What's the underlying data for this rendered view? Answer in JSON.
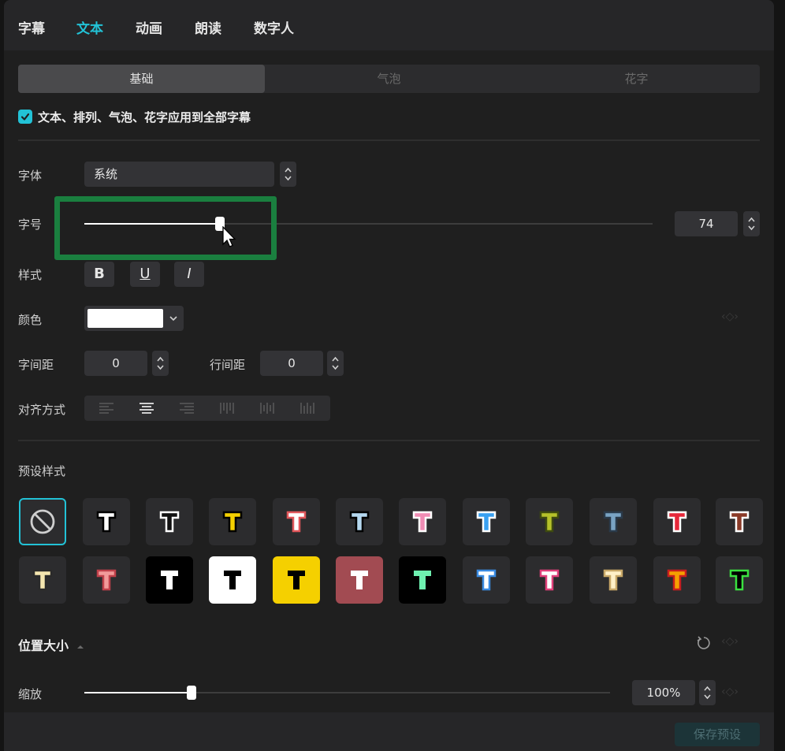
{
  "top_tabs": [
    "字幕",
    "文本",
    "动画",
    "朗读",
    "数字人"
  ],
  "active_top_tab": "文本",
  "sub_tabs": [
    "基础",
    "气泡",
    "花字"
  ],
  "active_sub_tab": "基础",
  "apply_all": {
    "label": "文本、排列、气泡、花字应用到全部字幕",
    "checked": true
  },
  "font": {
    "label": "字体",
    "value": "系统"
  },
  "font_size": {
    "label": "字号",
    "value": "74",
    "slider_fraction": 0.24
  },
  "style": {
    "label": "样式",
    "buttons": [
      "B",
      "U",
      "I"
    ]
  },
  "color": {
    "label": "颜色",
    "value": "#ffffff"
  },
  "letter_spacing": {
    "label": "字间距",
    "value": "0"
  },
  "line_spacing": {
    "label": "行间距",
    "value": "0"
  },
  "alignment": {
    "label": "对齐方式",
    "options": [
      "left",
      "center",
      "right",
      "top-vertical",
      "center-vertical",
      "bottom-vertical"
    ],
    "selected": "center"
  },
  "presets": {
    "label": "预设样式",
    "items": [
      {
        "name": "none",
        "bg": "#2c2c2e",
        "fill": "none"
      },
      {
        "name": "white-black-stroke",
        "bg": "#2c2c2e",
        "fill": "#ffffff",
        "stroke": "#000000"
      },
      {
        "name": "outline-white",
        "bg": "#2c2c2e",
        "fill": "#111111",
        "stroke": "#ffffff"
      },
      {
        "name": "yellow-black",
        "bg": "#2c2c2e",
        "fill": "#f5d000",
        "stroke": "#000000"
      },
      {
        "name": "white-red",
        "bg": "#2c2c2e",
        "fill": "#ffffff",
        "stroke": "#e0565a"
      },
      {
        "name": "lightblue-black",
        "bg": "#2c2c2e",
        "fill": "#b5d8ef",
        "stroke": "#000000"
      },
      {
        "name": "pink-white",
        "bg": "#2c2c2e",
        "fill": "#f08cb4",
        "stroke": "#ffffff"
      },
      {
        "name": "blue-white",
        "bg": "#2c2c2e",
        "fill": "#3aa0f0",
        "stroke": "#ffffff"
      },
      {
        "name": "olive",
        "bg": "#2c2c2e",
        "fill": "#b6c22a",
        "stroke": "#3e4a10"
      },
      {
        "name": "steelblue",
        "bg": "#2c2c2e",
        "fill": "#7aa4c4",
        "stroke": "#2a3a4a"
      },
      {
        "name": "red-white",
        "bg": "#2c2c2e",
        "fill": "#e6283a",
        "stroke": "#ffffff"
      },
      {
        "name": "brown-white",
        "bg": "#2c2c2e",
        "fill": "#8a3a28",
        "stroke": "#ffffff"
      },
      {
        "name": "cream",
        "bg": "#2c2c2e",
        "fill": "#f4e6b0",
        "stroke": "#2a2a2a"
      },
      {
        "name": "salmon",
        "bg": "#2c2c2e",
        "fill": "#f29a9a",
        "stroke": "#c0404a"
      },
      {
        "name": "white-on-black",
        "bg": "#000000",
        "fill": "#ffffff",
        "stroke": "none"
      },
      {
        "name": "black-on-white",
        "bg": "#ffffff",
        "fill": "#000000",
        "stroke": "none"
      },
      {
        "name": "black-on-yellow",
        "bg": "#f5d000",
        "fill": "#000000",
        "stroke": "none"
      },
      {
        "name": "white-on-rose",
        "bg": "#a24b52",
        "fill": "#ffffff",
        "stroke": "none"
      },
      {
        "name": "mint-on-black",
        "bg": "#000000",
        "fill": "#6ef0b0",
        "stroke": "none"
      },
      {
        "name": "white-blue-shadow",
        "bg": "#2c2c2e",
        "fill": "#ffffff",
        "stroke": "#3a8ae0"
      },
      {
        "name": "white-pink-shadow",
        "bg": "#2c2c2e",
        "fill": "#ffffff",
        "stroke": "#e0407a"
      },
      {
        "name": "cream-shadow",
        "bg": "#2c2c2e",
        "fill": "#fff0c8",
        "stroke": "#c8a868"
      },
      {
        "name": "orange-red",
        "bg": "#2c2c2e",
        "fill": "#f5a000",
        "stroke": "#c81e1e"
      },
      {
        "name": "black-green",
        "bg": "#2c2c2e",
        "fill": "#000000",
        "stroke": "#3ae040"
      }
    ]
  },
  "position_size": {
    "label": "位置大小"
  },
  "scale": {
    "label": "缩放",
    "value": "100%",
    "slider_fraction": 0.2
  },
  "save_preset": "保存预设",
  "accent_color": "#22c2d6"
}
